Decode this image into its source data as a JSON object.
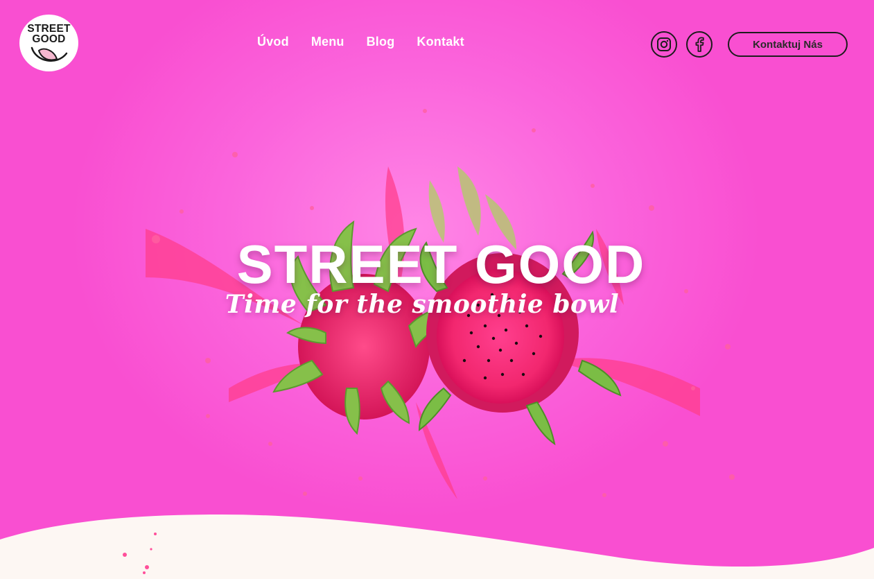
{
  "brand": {
    "logo_line1": "STREET",
    "logo_line2": "GOOD"
  },
  "nav": {
    "items": [
      "Úvod",
      "Menu",
      "Blog",
      "Kontakt"
    ]
  },
  "social": {
    "instagram_icon": "instagram-icon",
    "facebook_icon": "facebook-icon"
  },
  "cta": {
    "label": "Kontaktuj Nás"
  },
  "hero": {
    "title": "STREET GOOD",
    "tagline": "Time for the smoothie bowl"
  },
  "colors": {
    "background": "#f94fd1",
    "wave": "#fdf7f3",
    "text_light": "#ffffff",
    "outline_dark": "#1c1c1c"
  }
}
